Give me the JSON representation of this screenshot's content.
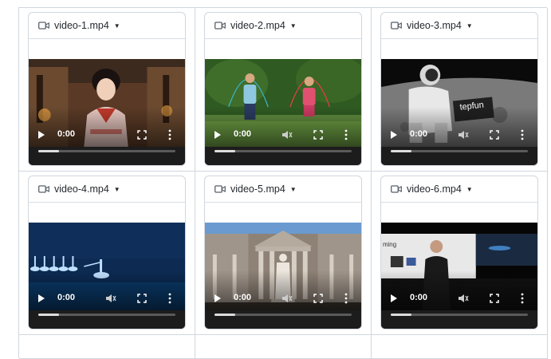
{
  "videos": [
    {
      "filename": "video-1.mp4",
      "time": "0:00",
      "scene": "girl-palace"
    },
    {
      "filename": "video-2.mp4",
      "time": "0:00",
      "scene": "jump-rope"
    },
    {
      "filename": "video-3.mp4",
      "time": "0:00",
      "scene": "astronaut-moon"
    },
    {
      "filename": "video-4.mp4",
      "time": "0:00",
      "scene": "ballet-stage"
    },
    {
      "filename": "video-5.mp4",
      "time": "0:00",
      "scene": "statue-courtyard"
    },
    {
      "filename": "video-6.mp4",
      "time": "0:00",
      "scene": "keynote-speaker"
    }
  ],
  "scene_text": {
    "sign3": "tepfun",
    "screen6": "ming"
  },
  "icons": {
    "header": "video-camera-icon",
    "dropdown": "chevron-down-icon",
    "play": "play-icon",
    "mute": "volume-muted-icon",
    "fullscreen": "fullscreen-icon",
    "menu": "more-vertical-icon"
  },
  "colors": {
    "border": "#d0d7de",
    "header_text": "#24292f",
    "control_bar": "#1c1c1c"
  }
}
